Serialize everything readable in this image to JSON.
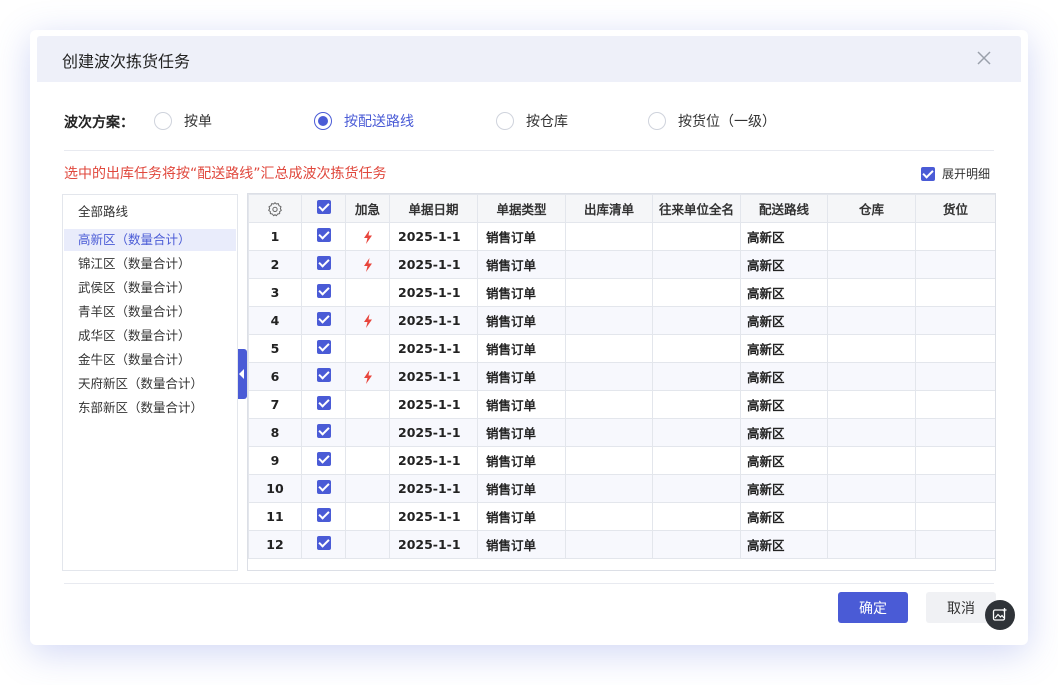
{
  "dialog": {
    "title": "创建波次拣货任务",
    "close_icon": "close-icon"
  },
  "scheme": {
    "label": "波次方案：",
    "options": [
      {
        "label": "按单",
        "selected": false
      },
      {
        "label": "按配送路线",
        "selected": true
      },
      {
        "label": "按仓库",
        "selected": false
      },
      {
        "label": "按货位（一级）",
        "selected": false
      }
    ]
  },
  "hint": "选中的出库任务将按“配送路线”汇总成波次拣货任务",
  "expand_detail": {
    "label": "展开明细",
    "checked": true
  },
  "sidebar": {
    "items": [
      {
        "label": "全部路线",
        "active": false
      },
      {
        "label": "高新区（数量合计）",
        "active": true
      },
      {
        "label": "锦江区（数量合计）",
        "active": false
      },
      {
        "label": "武侯区（数量合计）",
        "active": false
      },
      {
        "label": "青羊区（数量合计）",
        "active": false
      },
      {
        "label": "成华区（数量合计）",
        "active": false
      },
      {
        "label": "金牛区（数量合计）",
        "active": false
      },
      {
        "label": "天府新区（数量合计）",
        "active": false
      },
      {
        "label": "东部新区（数量合计）",
        "active": false
      }
    ]
  },
  "table": {
    "settings_icon": "gear-icon",
    "columns": [
      "加急",
      "单据日期",
      "单据类型",
      "出库清单",
      "往来单位全名",
      "配送路线",
      "仓库",
      "货位"
    ],
    "rows": [
      {
        "no": "1",
        "checked": true,
        "urgent": true,
        "date": "2025-1-1",
        "type": "销售订单",
        "list": "",
        "partner": "",
        "route": "高新区",
        "warehouse": "",
        "location": ""
      },
      {
        "no": "2",
        "checked": true,
        "urgent": true,
        "date": "2025-1-1",
        "type": "销售订单",
        "list": "",
        "partner": "",
        "route": "高新区",
        "warehouse": "",
        "location": ""
      },
      {
        "no": "3",
        "checked": true,
        "urgent": false,
        "date": "2025-1-1",
        "type": "销售订单",
        "list": "",
        "partner": "",
        "route": "高新区",
        "warehouse": "",
        "location": ""
      },
      {
        "no": "4",
        "checked": true,
        "urgent": true,
        "date": "2025-1-1",
        "type": "销售订单",
        "list": "",
        "partner": "",
        "route": "高新区",
        "warehouse": "",
        "location": ""
      },
      {
        "no": "5",
        "checked": true,
        "urgent": false,
        "date": "2025-1-1",
        "type": "销售订单",
        "list": "",
        "partner": "",
        "route": "高新区",
        "warehouse": "",
        "location": ""
      },
      {
        "no": "6",
        "checked": true,
        "urgent": true,
        "date": "2025-1-1",
        "type": "销售订单",
        "list": "",
        "partner": "",
        "route": "高新区",
        "warehouse": "",
        "location": ""
      },
      {
        "no": "7",
        "checked": true,
        "urgent": false,
        "date": "2025-1-1",
        "type": "销售订单",
        "list": "",
        "partner": "",
        "route": "高新区",
        "warehouse": "",
        "location": ""
      },
      {
        "no": "8",
        "checked": true,
        "urgent": false,
        "date": "2025-1-1",
        "type": "销售订单",
        "list": "",
        "partner": "",
        "route": "高新区",
        "warehouse": "",
        "location": ""
      },
      {
        "no": "9",
        "checked": true,
        "urgent": false,
        "date": "2025-1-1",
        "type": "销售订单",
        "list": "",
        "partner": "",
        "route": "高新区",
        "warehouse": "",
        "location": ""
      },
      {
        "no": "10",
        "checked": true,
        "urgent": false,
        "date": "2025-1-1",
        "type": "销售订单",
        "list": "",
        "partner": "",
        "route": "高新区",
        "warehouse": "",
        "location": ""
      },
      {
        "no": "11",
        "checked": true,
        "urgent": false,
        "date": "2025-1-1",
        "type": "销售订单",
        "list": "",
        "partner": "",
        "route": "高新区",
        "warehouse": "",
        "location": ""
      },
      {
        "no": "12",
        "checked": true,
        "urgent": false,
        "date": "2025-1-1",
        "type": "销售订单",
        "list": "",
        "partner": "",
        "route": "高新区",
        "warehouse": "",
        "location": ""
      }
    ]
  },
  "footer": {
    "ok_label": "确定",
    "cancel_label": "取消"
  },
  "colors": {
    "accent": "#4a5bd6",
    "hint": "#e0483d",
    "urgent": "#e8453c",
    "header_bg": "#eef0f9"
  }
}
